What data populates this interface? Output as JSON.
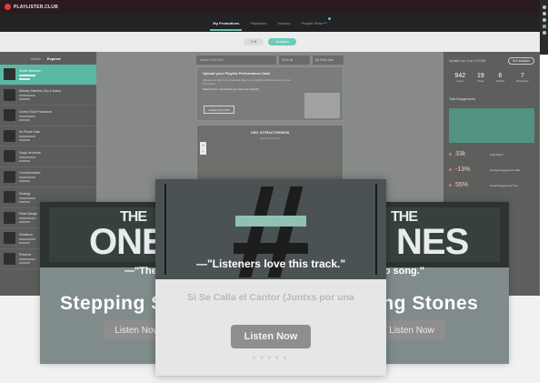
{
  "brand": {
    "name": "PLAYLISTER.CLUB"
  },
  "nav": {
    "items": [
      "My Promotions",
      "Playlisters",
      "Industry",
      "Playlist Pulse™"
    ],
    "active_index": 0
  },
  "subbar": {
    "pills": [
      "Edit",
      "Analytics"
    ],
    "active_index": 1
  },
  "left_panel": {
    "tabs": [
      "Active",
      "Expired"
    ],
    "tracks": [
      {
        "title": "Studio Sessions"
      },
      {
        "title": "Memory Machine (Jan & Adam)"
      },
      {
        "title": "Control Todo Promotions"
      },
      {
        "title": "Do Phone Calls"
      },
      {
        "title": "Cargo de fuerza"
      },
      {
        "title": "Convencionales"
      },
      {
        "title": "Strategy"
      },
      {
        "title": "Pieza Salvaje"
      },
      {
        "title": "Vibrations"
      },
      {
        "title": "Primeros"
      }
    ]
  },
  "middle": {
    "search_placeholder": "Search Post Feed",
    "filter_1": "Show all",
    "filter_2": "My Post Links",
    "upload_title": "Upload your Playlist Performance Data",
    "upload_text": "Upload your distributor streaming data to see playlist performance across your promotions.",
    "upload_link": "Watch how to download your data from Spotify",
    "upload_button": "Upload Your CSV",
    "map_title": "ORG. ATTRACTIVENESS",
    "map_sub": "Global Audience"
  },
  "right_panel": {
    "label": "Updated Jun 14 at 11:04 AM",
    "badge": "See analytics",
    "stats": [
      {
        "value": "942",
        "label": "Listens"
      },
      {
        "value": "19",
        "label": "Saves"
      },
      {
        "value": "6",
        "label": "Playlists"
      },
      {
        "value": "7",
        "label": "Placements"
      }
    ],
    "section": "Total Engagements",
    "kpis": [
      {
        "value": "33k",
        "text": "Total Reach"
      },
      {
        "value": "-13%",
        "text": "Average Engagement Rate"
      },
      {
        "value": "55%",
        "text": "Social Engagement Time"
      }
    ]
  },
  "ads": {
    "cover_left_top": "THE",
    "cover_left_main": "ONES",
    "cover_right_top": "THE",
    "cover_right_main": "NES",
    "quote_wide": "—\"The best new D                                          st new Disco song.\"",
    "title_wide_left": "Stepping S",
    "title_wide_right": "ing Stones",
    "listen_left": "Listen Now",
    "listen_right": "Listen Now",
    "quote_center": "—\"Listeners love this  track.\"",
    "song_name": "Si Se Calla el Cantor (Juntxs por una",
    "listen_center": "Listen Now",
    "stars": "★★★★★"
  },
  "colors": {
    "accent": "#5ec4b3",
    "brand_red": "#e23a3a",
    "dark": "#232224"
  }
}
